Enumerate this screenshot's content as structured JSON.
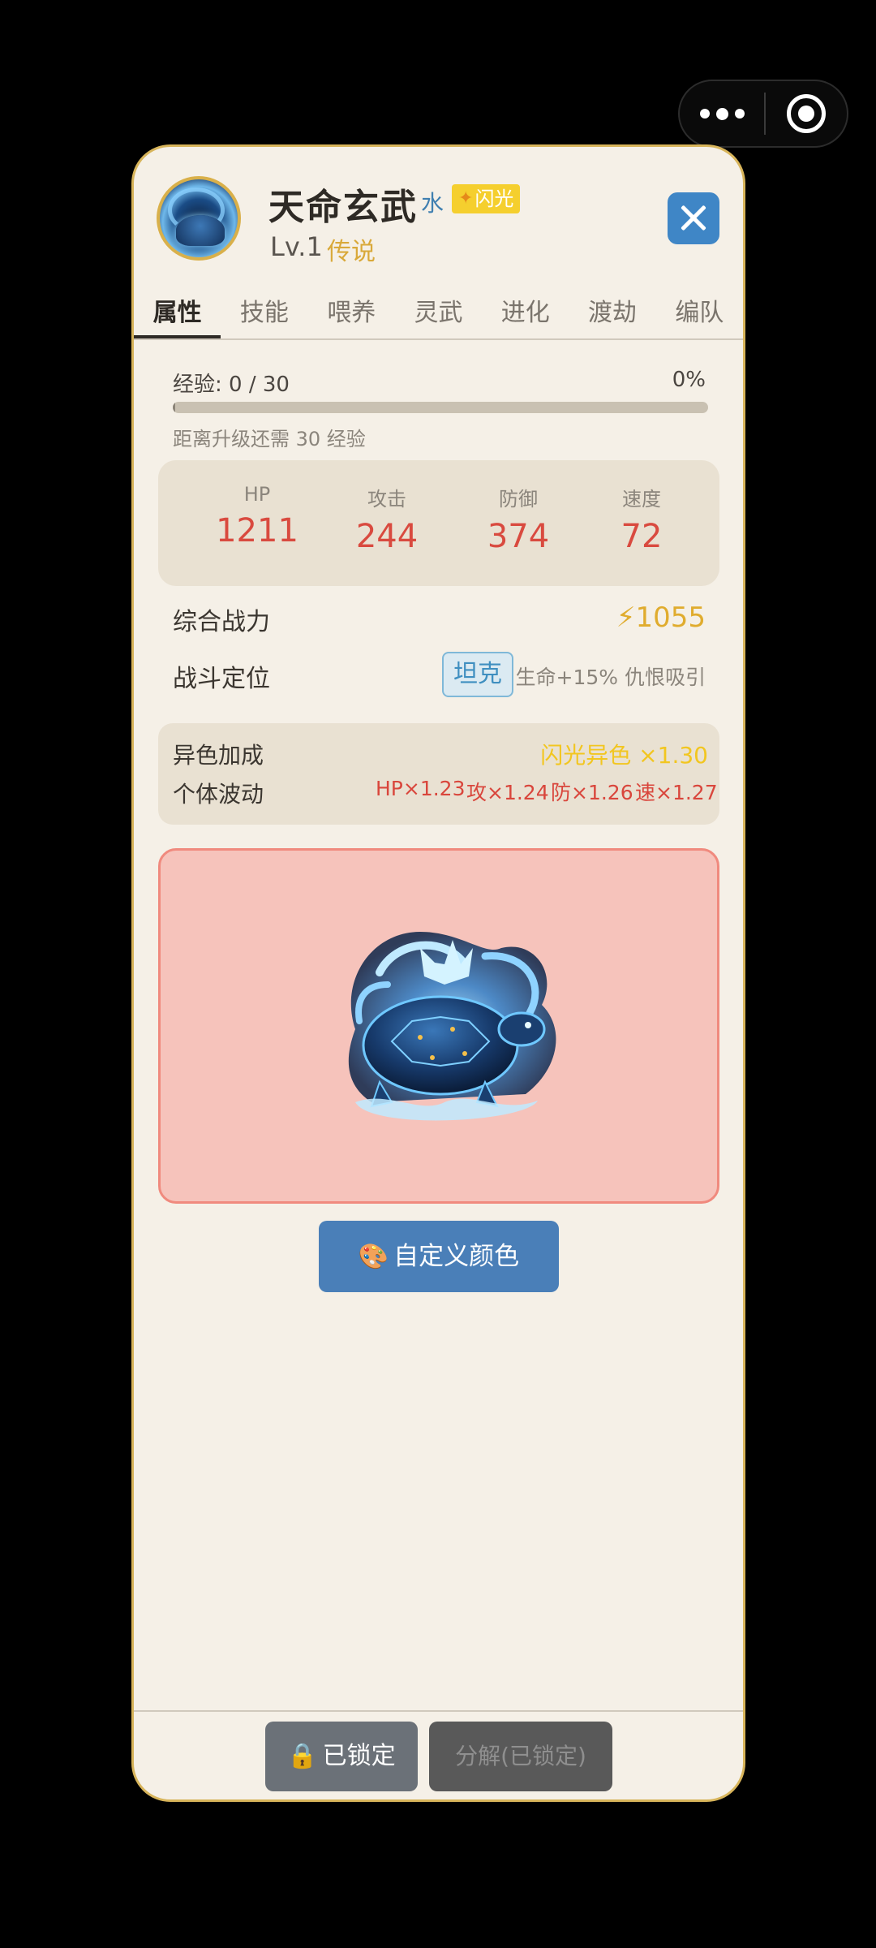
{
  "capsule": {
    "more_icon": "more-dots-icon",
    "close_icon": "target-circle-icon"
  },
  "header": {
    "title": "天命玄武",
    "element": "水",
    "shiny_badge": "闪光",
    "level": "Lv.1",
    "rarity": "传说",
    "avatar_icon": "turtle-avatar-icon"
  },
  "tabs": [
    {
      "label": "属性",
      "active": true
    },
    {
      "label": "技能"
    },
    {
      "label": "喂养"
    },
    {
      "label": "灵武"
    },
    {
      "label": "进化"
    },
    {
      "label": "渡劫"
    },
    {
      "label": "编队"
    }
  ],
  "exp": {
    "label": "经验: 0 / 30",
    "percent_label": "0%",
    "progress": 0,
    "hint": "距离升级还需 30 经验"
  },
  "stats": [
    {
      "label": "HP",
      "value": "1211"
    },
    {
      "label": "攻击",
      "value": "244"
    },
    {
      "label": "防御",
      "value": "374"
    },
    {
      "label": "速度",
      "value": "72"
    }
  ],
  "power": {
    "label": "综合战力",
    "value": "⚡1055"
  },
  "role": {
    "label": "战斗定位",
    "tag": "坦克",
    "desc": "生命+15% 仇恨吸引"
  },
  "bonus": {
    "shiny_label": "异色加成",
    "shiny_value": "闪光异色 ×1.30",
    "iv_label": "个体波动",
    "iv_values": [
      "HP×1.23",
      "攻×1.24",
      "防×1.26",
      "速×1.27"
    ]
  },
  "preview": {
    "background": "#f6c3bb",
    "creature_icon": "black-tortoise-icon"
  },
  "buttons": {
    "custom_color": "自定义颜色",
    "locked": "已锁定",
    "decompose": "分解(已锁定)"
  },
  "colors": {
    "accent": "#3f86c6",
    "gold": "#d7b45a",
    "stat_red": "#d94a3f"
  }
}
